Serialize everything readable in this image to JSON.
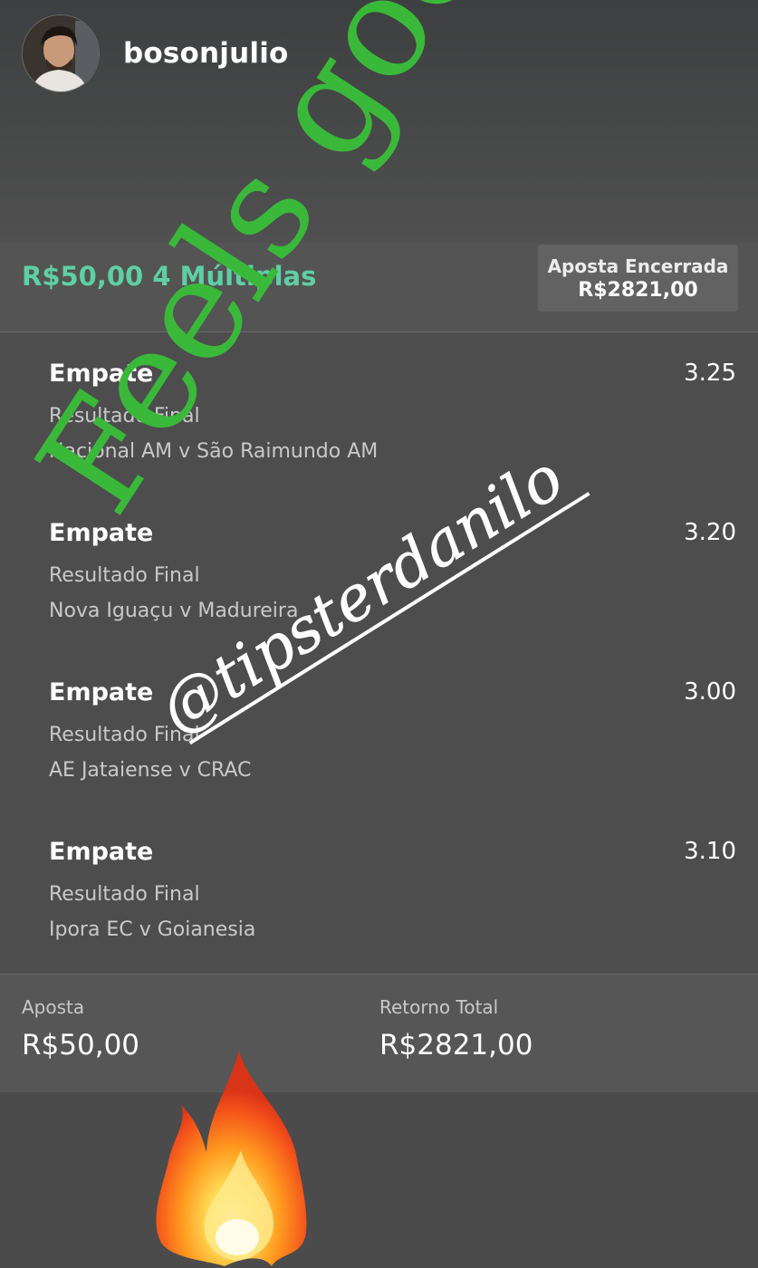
{
  "story": {
    "username": "bosonjulio"
  },
  "bet": {
    "title": "R$50,00 4 Múltiplas",
    "status_label": "Aposta Encerrada",
    "status_value": "R$2821,00"
  },
  "selections": [
    {
      "pick": "Empate",
      "odds": "3.25",
      "market": "Resultado Final",
      "match": "Nacional AM v São Raimundo AM"
    },
    {
      "pick": "Empate",
      "odds": "3.20",
      "market": "Resultado Final",
      "match": "Nova Iguaçu v Madureira"
    },
    {
      "pick": "Empate",
      "odds": "3.00",
      "market": "Resultado Final",
      "match": "AE Jataiense v CRAC"
    },
    {
      "pick": "Empate",
      "odds": "3.10",
      "market": "Resultado Final",
      "match": "Ipora EC v Goianesia"
    }
  ],
  "summary": {
    "stake_label": "Aposta",
    "stake_value": "R$50,00",
    "return_label": "Retorno Total",
    "return_value": "R$2821,00"
  },
  "overlays": {
    "feels_good": "Feels good",
    "handle": "@tipsterdanilo",
    "feels_good_color": "#3ab83a",
    "fire_emoji": "fire-icon"
  },
  "colors": {
    "accent_green": "#5ecfa7"
  }
}
